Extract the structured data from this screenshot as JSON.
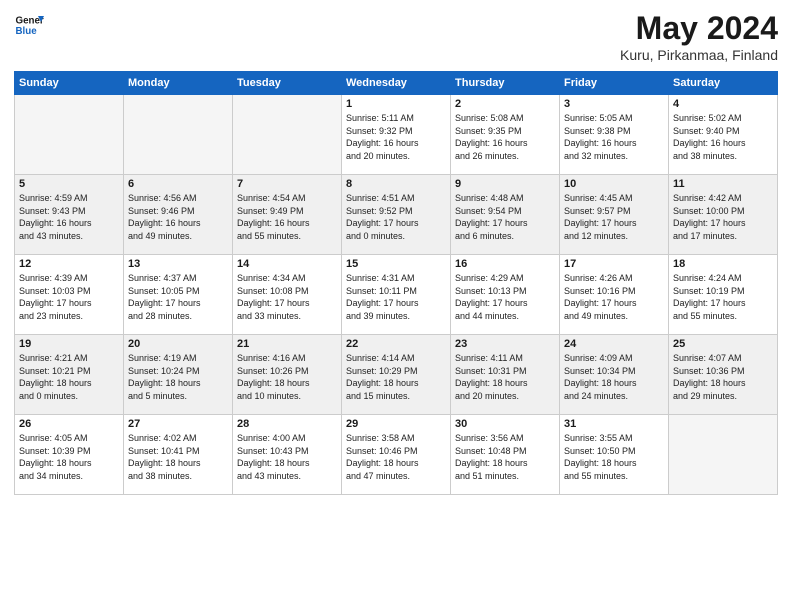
{
  "header": {
    "logo_line1": "General",
    "logo_line2": "Blue",
    "month_title": "May 2024",
    "location": "Kuru, Pirkanmaa, Finland"
  },
  "weekdays": [
    "Sunday",
    "Monday",
    "Tuesday",
    "Wednesday",
    "Thursday",
    "Friday",
    "Saturday"
  ],
  "weeks": [
    [
      {
        "day": "",
        "info": ""
      },
      {
        "day": "",
        "info": ""
      },
      {
        "day": "",
        "info": ""
      },
      {
        "day": "1",
        "info": "Sunrise: 5:11 AM\nSunset: 9:32 PM\nDaylight: 16 hours\nand 20 minutes."
      },
      {
        "day": "2",
        "info": "Sunrise: 5:08 AM\nSunset: 9:35 PM\nDaylight: 16 hours\nand 26 minutes."
      },
      {
        "day": "3",
        "info": "Sunrise: 5:05 AM\nSunset: 9:38 PM\nDaylight: 16 hours\nand 32 minutes."
      },
      {
        "day": "4",
        "info": "Sunrise: 5:02 AM\nSunset: 9:40 PM\nDaylight: 16 hours\nand 38 minutes."
      }
    ],
    [
      {
        "day": "5",
        "info": "Sunrise: 4:59 AM\nSunset: 9:43 PM\nDaylight: 16 hours\nand 43 minutes."
      },
      {
        "day": "6",
        "info": "Sunrise: 4:56 AM\nSunset: 9:46 PM\nDaylight: 16 hours\nand 49 minutes."
      },
      {
        "day": "7",
        "info": "Sunrise: 4:54 AM\nSunset: 9:49 PM\nDaylight: 16 hours\nand 55 minutes."
      },
      {
        "day": "8",
        "info": "Sunrise: 4:51 AM\nSunset: 9:52 PM\nDaylight: 17 hours\nand 0 minutes."
      },
      {
        "day": "9",
        "info": "Sunrise: 4:48 AM\nSunset: 9:54 PM\nDaylight: 17 hours\nand 6 minutes."
      },
      {
        "day": "10",
        "info": "Sunrise: 4:45 AM\nSunset: 9:57 PM\nDaylight: 17 hours\nand 12 minutes."
      },
      {
        "day": "11",
        "info": "Sunrise: 4:42 AM\nSunset: 10:00 PM\nDaylight: 17 hours\nand 17 minutes."
      }
    ],
    [
      {
        "day": "12",
        "info": "Sunrise: 4:39 AM\nSunset: 10:03 PM\nDaylight: 17 hours\nand 23 minutes."
      },
      {
        "day": "13",
        "info": "Sunrise: 4:37 AM\nSunset: 10:05 PM\nDaylight: 17 hours\nand 28 minutes."
      },
      {
        "day": "14",
        "info": "Sunrise: 4:34 AM\nSunset: 10:08 PM\nDaylight: 17 hours\nand 33 minutes."
      },
      {
        "day": "15",
        "info": "Sunrise: 4:31 AM\nSunset: 10:11 PM\nDaylight: 17 hours\nand 39 minutes."
      },
      {
        "day": "16",
        "info": "Sunrise: 4:29 AM\nSunset: 10:13 PM\nDaylight: 17 hours\nand 44 minutes."
      },
      {
        "day": "17",
        "info": "Sunrise: 4:26 AM\nSunset: 10:16 PM\nDaylight: 17 hours\nand 49 minutes."
      },
      {
        "day": "18",
        "info": "Sunrise: 4:24 AM\nSunset: 10:19 PM\nDaylight: 17 hours\nand 55 minutes."
      }
    ],
    [
      {
        "day": "19",
        "info": "Sunrise: 4:21 AM\nSunset: 10:21 PM\nDaylight: 18 hours\nand 0 minutes."
      },
      {
        "day": "20",
        "info": "Sunrise: 4:19 AM\nSunset: 10:24 PM\nDaylight: 18 hours\nand 5 minutes."
      },
      {
        "day": "21",
        "info": "Sunrise: 4:16 AM\nSunset: 10:26 PM\nDaylight: 18 hours\nand 10 minutes."
      },
      {
        "day": "22",
        "info": "Sunrise: 4:14 AM\nSunset: 10:29 PM\nDaylight: 18 hours\nand 15 minutes."
      },
      {
        "day": "23",
        "info": "Sunrise: 4:11 AM\nSunset: 10:31 PM\nDaylight: 18 hours\nand 20 minutes."
      },
      {
        "day": "24",
        "info": "Sunrise: 4:09 AM\nSunset: 10:34 PM\nDaylight: 18 hours\nand 24 minutes."
      },
      {
        "day": "25",
        "info": "Sunrise: 4:07 AM\nSunset: 10:36 PM\nDaylight: 18 hours\nand 29 minutes."
      }
    ],
    [
      {
        "day": "26",
        "info": "Sunrise: 4:05 AM\nSunset: 10:39 PM\nDaylight: 18 hours\nand 34 minutes."
      },
      {
        "day": "27",
        "info": "Sunrise: 4:02 AM\nSunset: 10:41 PM\nDaylight: 18 hours\nand 38 minutes."
      },
      {
        "day": "28",
        "info": "Sunrise: 4:00 AM\nSunset: 10:43 PM\nDaylight: 18 hours\nand 43 minutes."
      },
      {
        "day": "29",
        "info": "Sunrise: 3:58 AM\nSunset: 10:46 PM\nDaylight: 18 hours\nand 47 minutes."
      },
      {
        "day": "30",
        "info": "Sunrise: 3:56 AM\nSunset: 10:48 PM\nDaylight: 18 hours\nand 51 minutes."
      },
      {
        "day": "31",
        "info": "Sunrise: 3:55 AM\nSunset: 10:50 PM\nDaylight: 18 hours\nand 55 minutes."
      },
      {
        "day": "",
        "info": ""
      }
    ]
  ]
}
